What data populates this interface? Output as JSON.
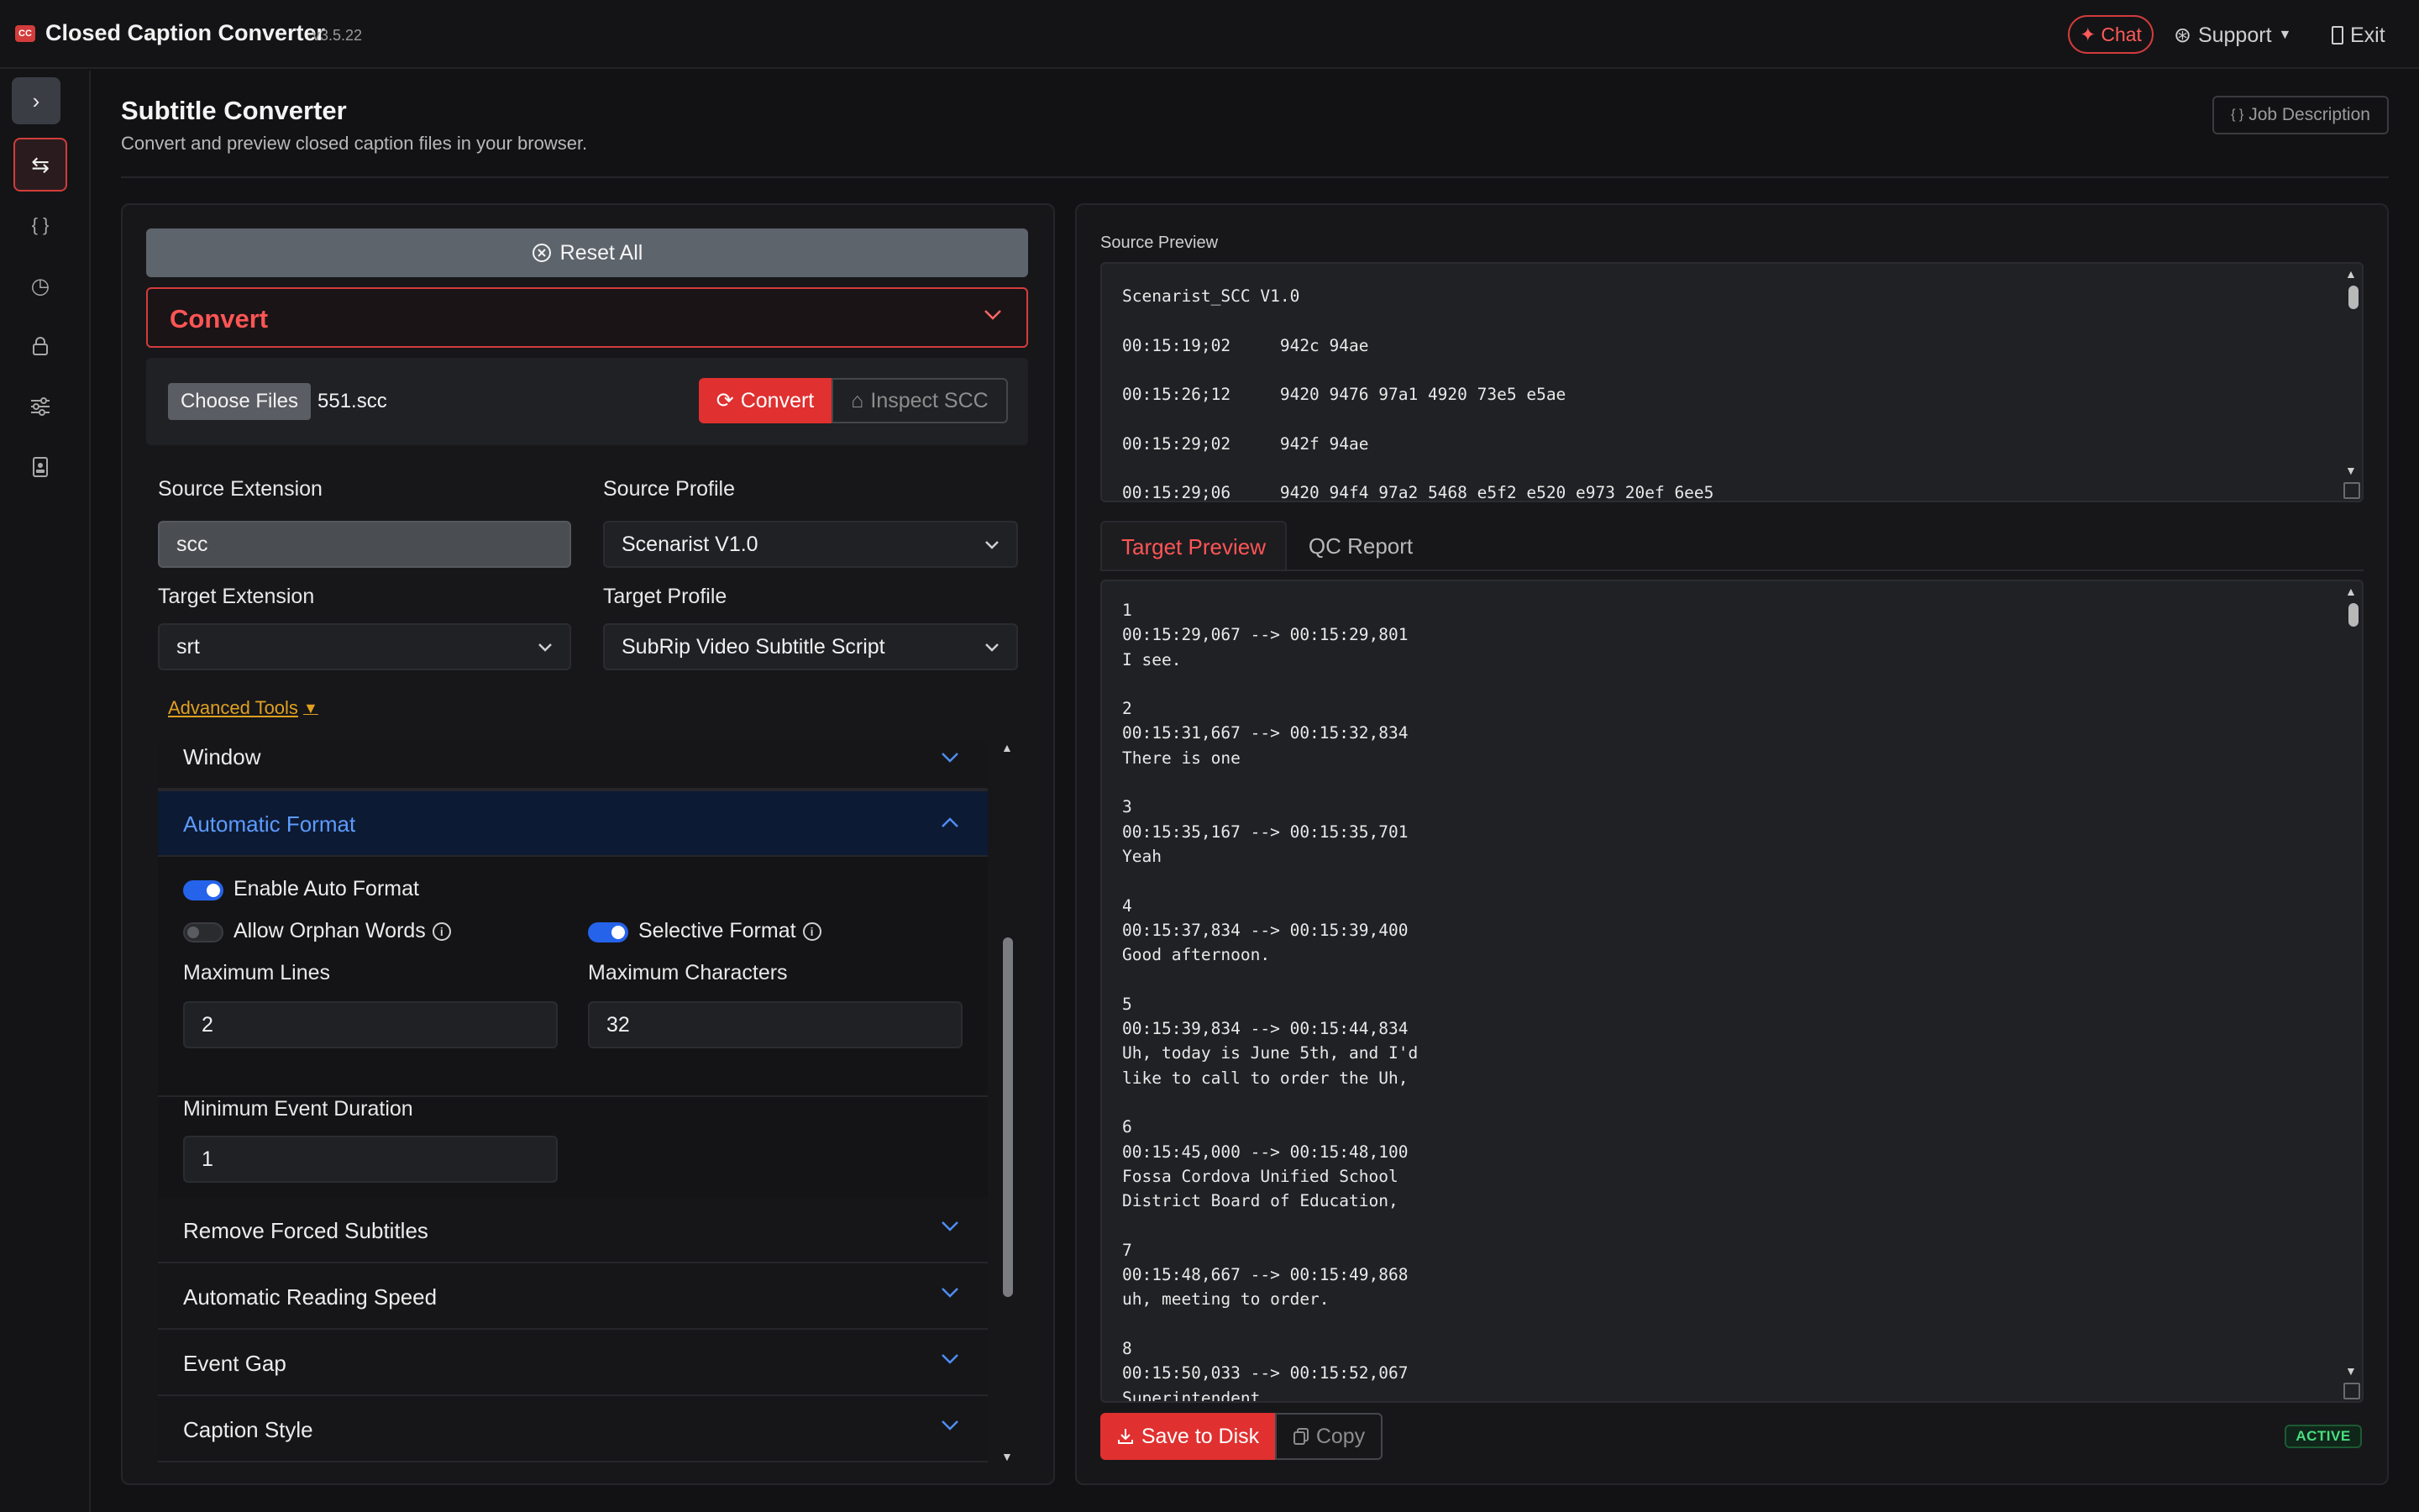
{
  "app": {
    "logo_text": "CC",
    "title": "Closed Caption Converter",
    "version": "v3.5.22"
  },
  "topbar": {
    "chat_label": "Chat",
    "support_label": "Support",
    "exit_label": "Exit"
  },
  "sidebar": {
    "items": [
      {
        "name": "expand",
        "icon": "chevron-right-icon"
      },
      {
        "name": "convert",
        "icon": "swap-arrows-icon",
        "active": true
      },
      {
        "name": "json",
        "icon": "braces-icon"
      },
      {
        "name": "history",
        "icon": "clock-icon"
      },
      {
        "name": "security",
        "icon": "lock-icon"
      },
      {
        "name": "settings",
        "icon": "sliders-icon"
      },
      {
        "name": "account",
        "icon": "id-badge-icon"
      }
    ]
  },
  "header": {
    "title": "Subtitle Converter",
    "subtitle": "Convert and preview closed caption files in your browser.",
    "job_description_label": "Job Description"
  },
  "left": {
    "reset_label": "Reset All",
    "convert_section_label": "Convert",
    "choose_files_label": "Choose Files",
    "file_name": "551.scc",
    "convert_button_label": "Convert",
    "inspect_button_label": "Inspect SCC",
    "source_extension_label": "Source Extension",
    "source_extension_value": "scc",
    "source_profile_label": "Source Profile",
    "source_profile_value": "Scenarist V1.0",
    "target_extension_label": "Target Extension",
    "target_extension_value": "srt",
    "target_profile_label": "Target Profile",
    "target_profile_value": "SubRip Video Subtitle Script",
    "advanced_tools_label": "Advanced Tools"
  },
  "advanced": {
    "window_label": "Window",
    "automatic_format_label": "Automatic Format",
    "enable_auto_format_label": "Enable Auto Format",
    "enable_auto_format": true,
    "allow_orphan_words_label": "Allow Orphan Words",
    "allow_orphan_words": false,
    "selective_format_label": "Selective Format",
    "selective_format": true,
    "max_lines_label": "Maximum Lines",
    "max_lines_value": "2",
    "max_chars_label": "Maximum Characters",
    "max_chars_value": "32",
    "min_event_duration_label": "Minimum Event Duration",
    "min_event_duration_value": "1",
    "remove_forced_label": "Remove Forced Subtitles",
    "auto_reading_speed_label": "Automatic Reading Speed",
    "event_gap_label": "Event Gap",
    "caption_style_label": "Caption Style"
  },
  "right": {
    "source_preview_label": "Source Preview",
    "source_preview_text": "Scenarist_SCC V1.0\n\n00:15:19;02     942c 94ae\n\n00:15:26;12     9420 9476 97a1 4920 73e5 e5ae\n\n00:15:29;02     942f 94ae\n\n00:15:29;06     9420 94f4 97a2 5468 e5f2 e520 e973 20ef 6ee5",
    "tab_target_label": "Target Preview",
    "tab_qc_label": "QC Report",
    "target_preview_text": "1\n00:15:29,067 --> 00:15:29,801\nI see.\n\n2\n00:15:31,667 --> 00:15:32,834\nThere is one\n\n3\n00:15:35,167 --> 00:15:35,701\nYeah\n\n4\n00:15:37,834 --> 00:15:39,400\nGood afternoon.\n\n5\n00:15:39,834 --> 00:15:44,834\nUh, today is June 5th, and I'd\nlike to call to order the Uh,\n\n6\n00:15:45,000 --> 00:15:48,100\nFossa Cordova Unified School\nDistrict Board of Education,\n\n7\n00:15:48,667 --> 00:15:49,868\nuh, meeting to order.\n\n8\n00:15:50,033 --> 00:15:52,067\nSuperintendent",
    "save_label": "Save to Disk",
    "copy_label": "Copy",
    "status_badge": "ACTIVE"
  },
  "colors": {
    "accent_red": "#e03030",
    "accent_blue": "#2563eb",
    "link_amber": "#e0a020",
    "status_green": "#4ade80"
  }
}
